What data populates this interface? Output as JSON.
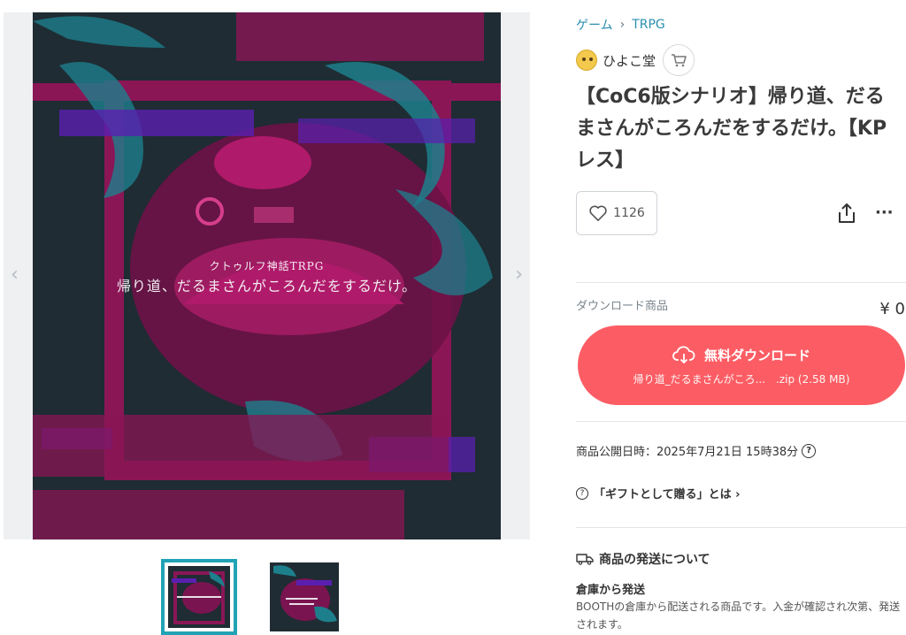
{
  "gallery": {
    "art_subtitle": "クトゥルフ神話TRPG",
    "art_title": "帰り道、だるまさんがころんだをするだけ。",
    "prev_arrow": "‹",
    "next_arrow": "›"
  },
  "breadcrumb": [
    "ゲーム",
    "TRPG"
  ],
  "breadcrumb_separator": "›",
  "shop": {
    "name": "ひよこ堂"
  },
  "product": {
    "title": "【CoC6版シナリオ】帰り道、だるまさんがころんだをするだけ。【KPレス】"
  },
  "likes": {
    "count": "1126"
  },
  "more_label": "···",
  "download": {
    "label": "ダウンロード商品",
    "price": "¥ 0",
    "button_label": "無料ダウンロード",
    "file_label": "帰り道_だるまさんがころ...　.zip (2.58 MB)"
  },
  "published": {
    "text": "商品公開日時：2025年7月21日 15時38分",
    "help_icon": "?"
  },
  "gift": {
    "icon": "?",
    "text": "「ギフトとして贈る」とは ›"
  },
  "shipping": {
    "heading": "商品の発送について",
    "sub": "倉庫から発送",
    "desc": "BOOTHの倉庫から配送される商品です。入金が確認され次第、発送されます。"
  },
  "colors": {
    "accent": "#fc5d64",
    "link": "#2a8fb0",
    "thumb_border": "#21a3b5",
    "art_bg": "#1f2c33",
    "art_magenta": "#b01a6a",
    "art_teal": "#1d7f8c",
    "art_purple": "#5a1fb0"
  },
  "icons": {
    "cart": "cart-icon",
    "heart": "heart-icon",
    "share": "share-icon",
    "cloud": "cloud-download-icon",
    "truck": "truck-icon"
  }
}
